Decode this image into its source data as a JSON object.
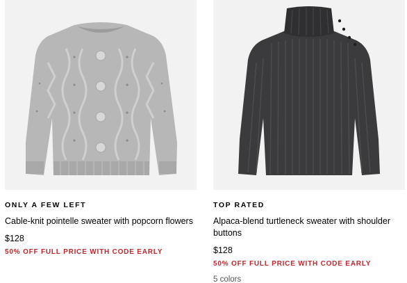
{
  "products": [
    {
      "badge": "ONLY A FEW LEFT",
      "title": "Cable-knit pointelle sweater with popcorn flowers",
      "price": "$128",
      "promo": "50% OFF FULL PRICE WITH CODE EARLY",
      "colors": "",
      "image_color": "#b9b9b9",
      "image_alt": "light grey cable-knit sweater"
    },
    {
      "badge": "TOP RATED",
      "title": "Alpaca-blend turtleneck sweater with shoulder buttons",
      "price": "$128",
      "promo": "50% OFF FULL PRICE WITH CODE EARLY",
      "colors": "5 colors",
      "image_color": "#3a3a3c",
      "image_alt": "charcoal ribbed turtleneck sweater"
    }
  ],
  "theme": {
    "promo_color": "#c0282e",
    "image_background": "#f2f2f2"
  }
}
